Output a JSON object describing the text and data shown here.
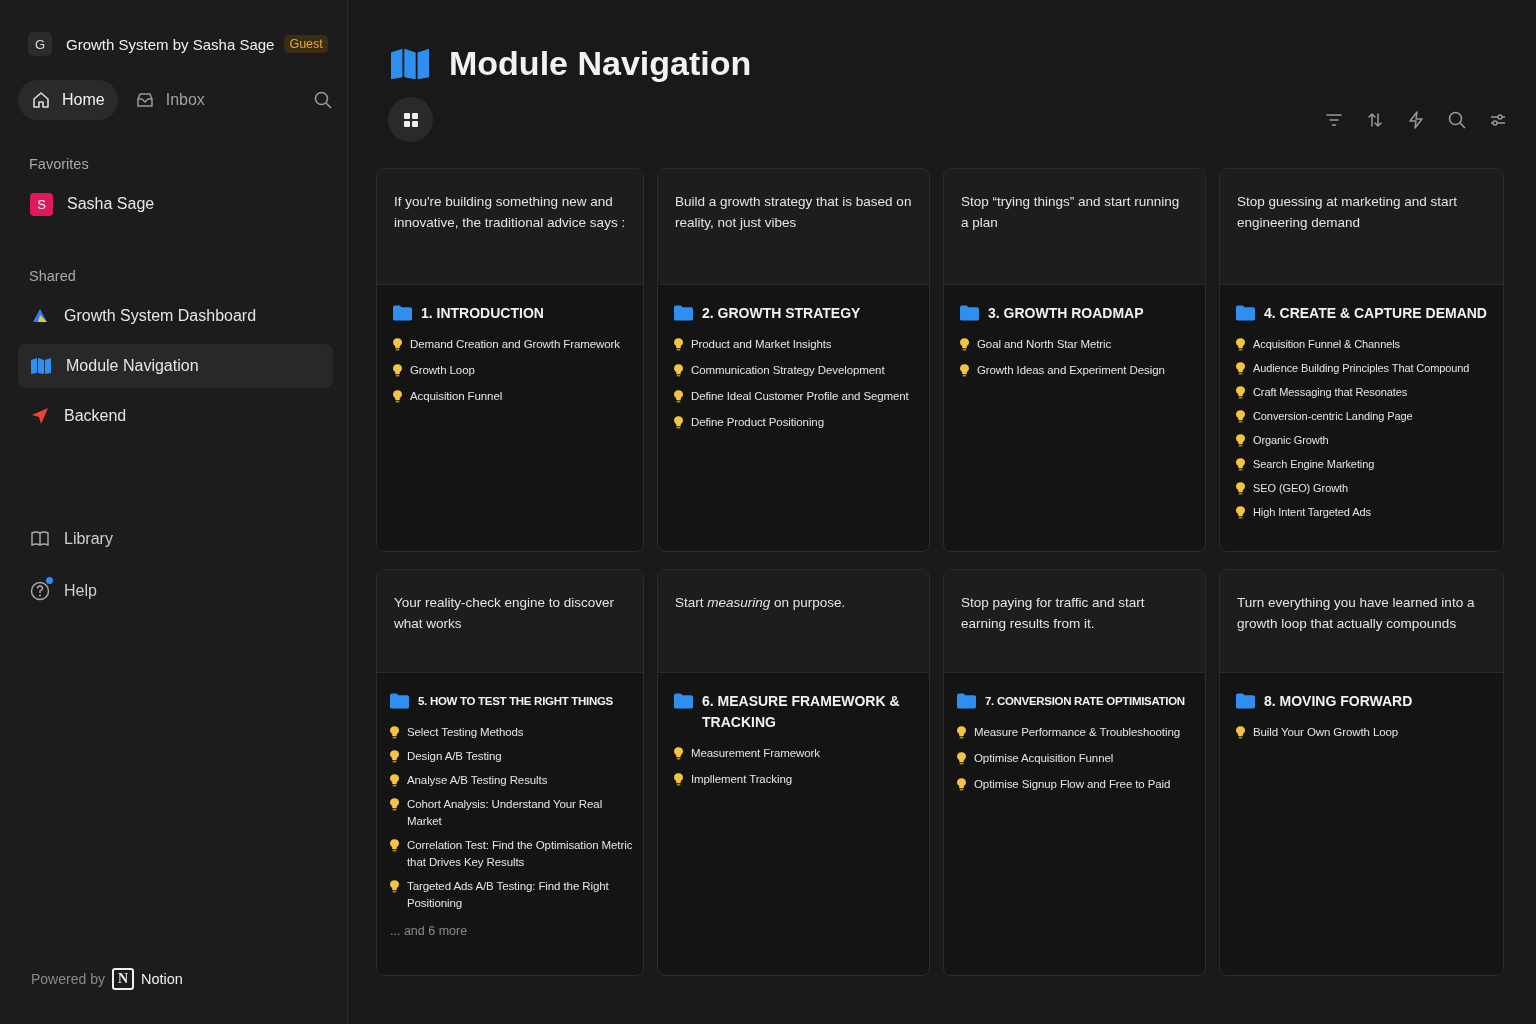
{
  "workspace": {
    "initial": "G",
    "name": "Growth System by Sasha Sage",
    "badge": "Guest"
  },
  "nav": [
    {
      "label": "Home",
      "kind": "home",
      "selected": true
    },
    {
      "label": "Inbox",
      "kind": "inbox",
      "selected": false
    }
  ],
  "sections": [
    {
      "title": "Favorites",
      "items": [
        {
          "label": "Sasha Sage",
          "kind": "avatar",
          "initial": "S",
          "selected": false
        }
      ]
    },
    {
      "title": "Shared",
      "items": [
        {
          "label": "Growth System Dashboard",
          "kind": "triangle",
          "selected": false
        },
        {
          "label": "Module Navigation",
          "kind": "map",
          "selected": true
        },
        {
          "label": "Backend",
          "kind": "send",
          "selected": false
        }
      ]
    }
  ],
  "bottom_links": [
    {
      "label": "Library",
      "kind": "book",
      "has_notification": false
    },
    {
      "label": "Help",
      "kind": "help",
      "has_notification": true
    }
  ],
  "footer": {
    "prefix": "Powered by",
    "brand_initial": "N",
    "brand": "Notion"
  },
  "page": {
    "title": "Module Navigation"
  },
  "modules": [
    {
      "tagline": "If you're building something new and innovative, the traditional advice says :",
      "title": "1. INTRODUCTION",
      "lessons": [
        "Demand Creation and Growth Framework",
        "Growth Loop",
        "Acquisition Funnel"
      ]
    },
    {
      "tagline": "Build a growth strategy that is based on reality, not just vibes",
      "title": "2. GROWTH STRATEGY",
      "lessons": [
        "Product and Market Insights",
        "Communication Strategy Development",
        "Define Ideal Customer Profile and Segment",
        "Define Product Positioning"
      ]
    },
    {
      "tagline": "Stop “trying things” and start running a plan",
      "title": "3. GROWTH ROADMAP",
      "lessons": [
        "Goal and North Star Metric",
        "Growth Ideas and Experiment Design"
      ]
    },
    {
      "tagline": "Stop guessing at marketing and start engineering demand",
      "title": "4. CREATE & CAPTURE DEMAND",
      "lessons": [
        "Acquisition Funnel & Channels",
        "Audience Building Principles That Compound",
        "Craft Messaging that Resonates",
        "Conversion-centric Landing Page",
        "Organic Growth",
        "Search Engine Marketing",
        "SEO (GEO) Growth",
        "High Intent Targeted Ads"
      ]
    },
    {
      "tagline": "Your reality-check engine to discover what works",
      "title": "5. HOW TO TEST THE RIGHT THINGS",
      "lessons": [
        "Select Testing Methods",
        "Design A/B Testing",
        "Analyse A/B Testing Results",
        "Cohort Analysis: Understand Your Real Market",
        "Correlation Test: Find the Optimisation Metric that Drives Key Results",
        "Targeted Ads A/B Testing: Find the Right Positioning"
      ],
      "more": "... and 6 more"
    },
    {
      "tagline": "Start *measuring* on purpose.",
      "title": "6. MEASURE FRAMEWORK & TRACKING",
      "lessons": [
        "Measurement Framework",
        "Impllement Tracking"
      ]
    },
    {
      "tagline": "Stop paying for traffic and start earning results from it.",
      "title": "7. CONVERSION RATE OPTIMISATION",
      "lessons": [
        "Measure Performance & Troubleshooting",
        "Optimise Acquisition Funnel",
        "Optimise Signup Flow and Free to Paid"
      ]
    },
    {
      "tagline": "Turn everything you have learned into a growth loop that actually compounds",
      "title": "8. MOVING FORWARD",
      "lessons": [
        "Build Your Own Growth Loop"
      ]
    }
  ]
}
